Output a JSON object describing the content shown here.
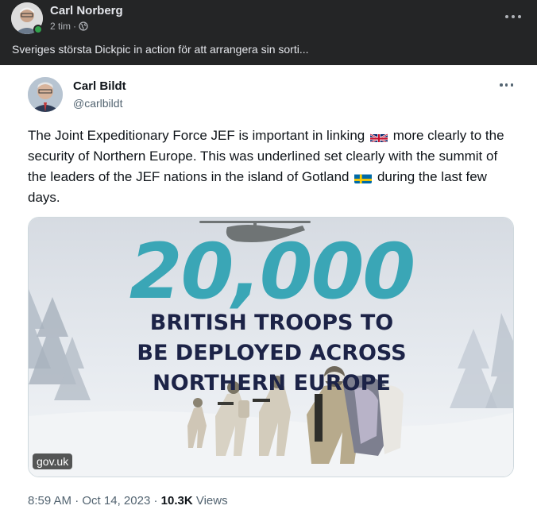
{
  "fb_post": {
    "author": "Carl Norberg",
    "time": "2 tim",
    "separator": "·",
    "privacy_icon": "globe-icon",
    "text": "Sveriges största Dickpic in action för att arrangera sin sorti...",
    "more_icon": "more-horizontal-icon"
  },
  "tweet": {
    "name": "Carl Bildt",
    "handle": "@carlbildt",
    "text_part1": "The Joint Expeditionary Force JEF is important in linking",
    "text_part2": "more clearly to the security of Northern Europe. This was underlined  set clearly with the summit of the leaders of the JEF nations in the island of Gotland",
    "text_part3": "during the last few days.",
    "flag_1": "uk-flag-icon",
    "flag_2": "sweden-flag-icon",
    "media": {
      "big_number": "20,000",
      "headline_line1": "BRITISH TROOPS TO",
      "headline_line2": "BE DEPLOYED ACROSS",
      "headline_line3": "NORTHERN EUROPE",
      "source": "gov.uk"
    },
    "time": "8:59 AM",
    "date": "Oct 14, 2023",
    "separator": "·",
    "views_count": "10.3K",
    "views_label": "Views"
  },
  "colors": {
    "fb_header_bg": "#242526",
    "fb_online": "#31a24c",
    "number_teal": "#3aa6b6",
    "headline_navy": "#1c2347"
  }
}
